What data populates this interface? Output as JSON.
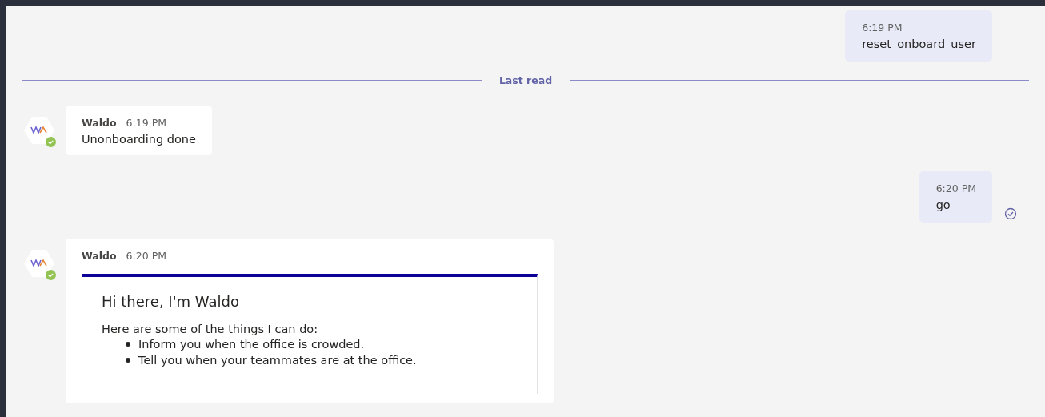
{
  "messages": [
    {
      "kind": "sent",
      "time": "6:19 PM",
      "text": "reset_onboard_user",
      "read": false
    },
    {
      "kind": "divider",
      "label": "Last read"
    },
    {
      "kind": "received",
      "sender": "Waldo",
      "time": "6:19 PM",
      "text": "Unonboarding done",
      "online": true
    },
    {
      "kind": "sent",
      "time": "6:20 PM",
      "text": "go",
      "read": true
    },
    {
      "kind": "card",
      "sender": "Waldo",
      "time": "6:20 PM",
      "online": true,
      "card": {
        "title": "Hi there, I'm Waldo",
        "intro": "Here are some of the things I can do:",
        "items": [
          "Inform you when the office is crowded.",
          "Tell you when your teammates are at the office."
        ]
      }
    }
  ]
}
